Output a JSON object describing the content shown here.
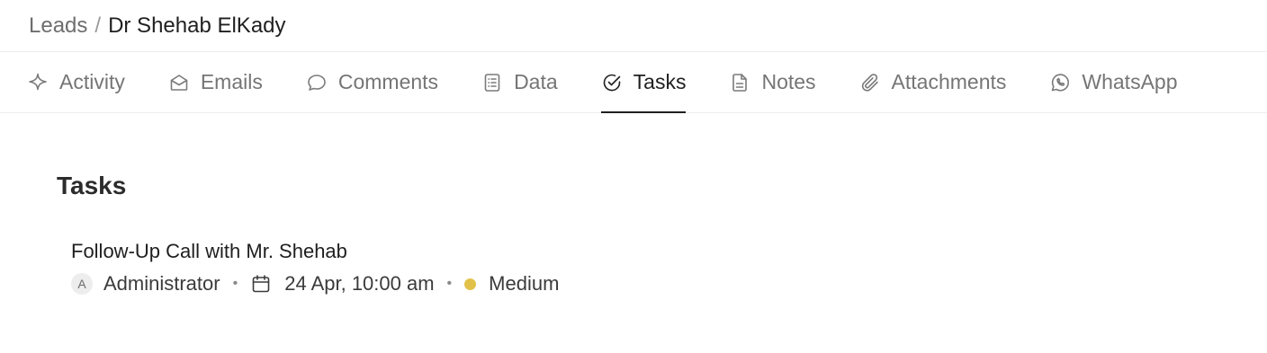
{
  "breadcrumb": {
    "parent": "Leads",
    "separator": "/",
    "current": "Dr Shehab ElKady"
  },
  "tabs": [
    {
      "label": "Activity",
      "icon": "activity-icon"
    },
    {
      "label": "Emails",
      "icon": "email-icon"
    },
    {
      "label": "Comments",
      "icon": "comment-icon"
    },
    {
      "label": "Data",
      "icon": "data-icon"
    },
    {
      "label": "Tasks",
      "icon": "task-check-icon",
      "active": true
    },
    {
      "label": "Notes",
      "icon": "note-icon"
    },
    {
      "label": "Attachments",
      "icon": "paperclip-icon"
    },
    {
      "label": "WhatsApp",
      "icon": "whatsapp-icon"
    }
  ],
  "tasks_section": {
    "title": "Tasks",
    "items": [
      {
        "title": "Follow-Up Call with Mr. Shehab",
        "assignee_initial": "A",
        "assignee": "Administrator",
        "meta_separator": "•",
        "due": "24 Apr, 10:00 am",
        "priority": "Medium",
        "priority_color": "#e2c14a"
      }
    ]
  }
}
